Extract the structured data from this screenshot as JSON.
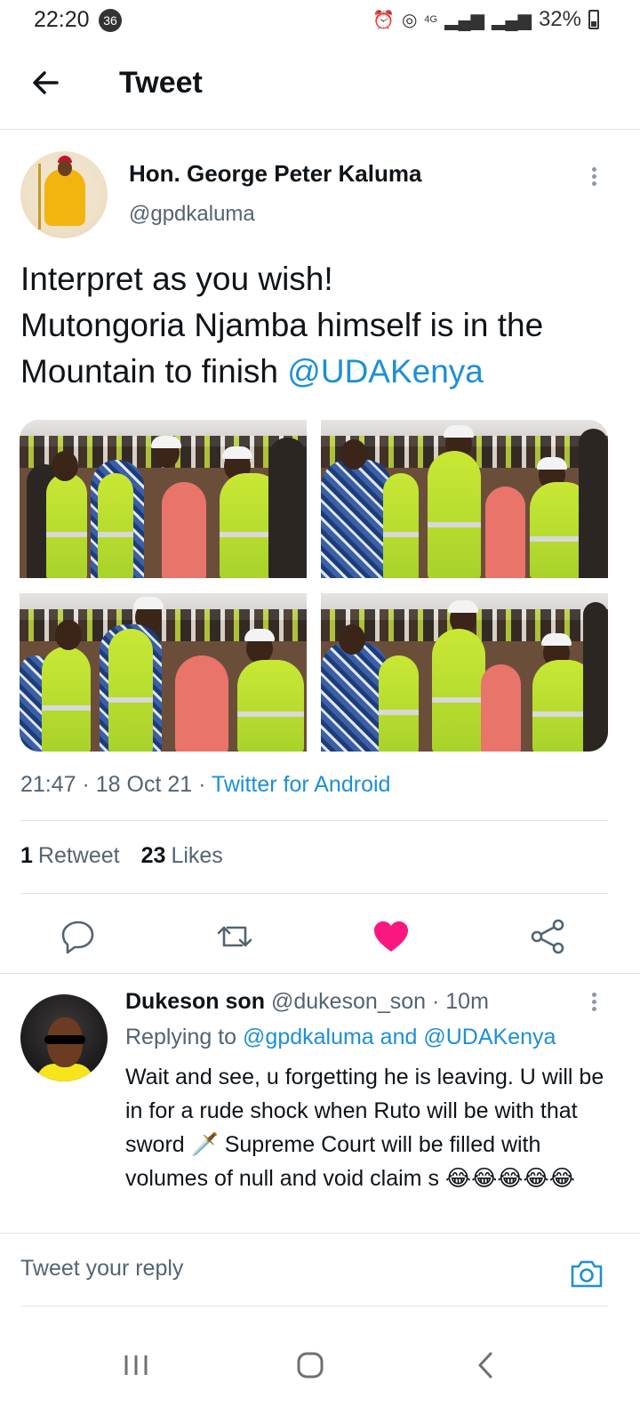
{
  "status_bar": {
    "time": "22:20",
    "notification_count": "36",
    "network": "4G",
    "battery": "32%"
  },
  "header": {
    "title": "Tweet"
  },
  "tweet": {
    "author_name": "Hon. George Peter Kaluma",
    "author_handle": "@gpdkaluma",
    "text_line1": "Interpret as you wish!",
    "text_line2": "Mutongoria Njamba himself is in the Mountain to finish ",
    "mention": "@UDAKenya",
    "time": "21:47",
    "date": "18 Oct 21",
    "source": "Twitter for Android",
    "retweet_count": "1",
    "retweet_label": "Retweet",
    "like_count": "23",
    "like_label": "Likes",
    "liked": true,
    "photo_count": 4
  },
  "actions": {
    "reply_icon": "reply-bubble-icon",
    "retweet_icon": "retweet-icon",
    "like_icon": "heart-icon",
    "share_icon": "share-icon"
  },
  "reply": {
    "author_name": "Dukeson son",
    "author_handle": "@dukeson_son",
    "time_ago": "10m",
    "replying_prefix": "Replying to ",
    "replying_to_1": "@gpdkaluma",
    "replying_and": " and ",
    "replying_to_2": "@UDAKenya",
    "text": "Wait and see, u forgetting he is leaving. U will be in for a rude shock when Ruto will be with that sword 🗡️ Supreme Court will be filled with volumes of null and void claim s 😂😂😂😂😂"
  },
  "composer": {
    "placeholder": "Tweet your reply"
  },
  "colors": {
    "accent": "#1d8fd8",
    "like": "#f91880",
    "secondary_text": "#536471"
  }
}
